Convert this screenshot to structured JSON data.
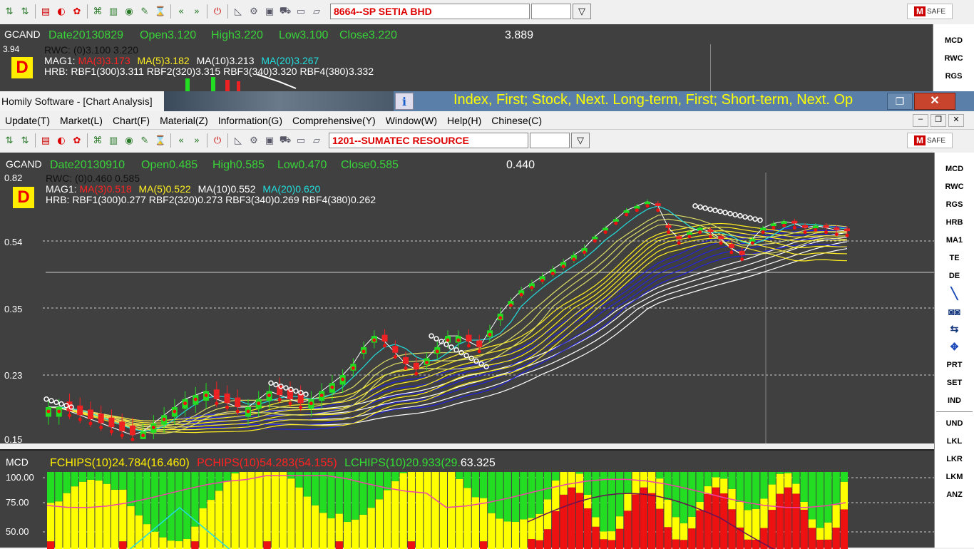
{
  "top_window": {
    "stock": "8664--SP SETIA BHD",
    "gcand": "GCAND",
    "date": "Date20130829",
    "open": "Open3.120",
    "high": "High3.220",
    "low": "Low3.100",
    "close": "Close3.220",
    "cursor_value": "3.889",
    "y_top": "3.94",
    "rwc": "RWC: (0)3.100   3.220",
    "mag1_prefix": "MAG1:",
    "ma3": "MA(3)3.173",
    "ma5": "MA(5)3.182",
    "ma10": "MA(10)3.213",
    "ma20": "MA(20)3.267",
    "hrb": "HRB: RBF1(300)3.311  RBF2(320)3.315  RBF3(340)3.320  RBF4(380)3.332",
    "d_badge": "D",
    "side": [
      "MCD",
      "RWC",
      "RGS"
    ]
  },
  "bar": {
    "title": "Homily Software - [Chart Analysis]",
    "info_icon": "i",
    "ticker": "Index, First; Stock, Next. Long-term, First; Short-term, Next. Op"
  },
  "menu": [
    "Update(T)",
    "Market(L)",
    "Chart(F)",
    "Material(Z)",
    "Information(G)",
    "Comprehensive(Y)",
    "Window(W)",
    "Help(H)",
    "Chinese(C)"
  ],
  "toolbar_icons": [
    "arrow-icon",
    "arrow-icon",
    "flag-my-icon",
    "flag-sg-icon",
    "flag-hk-icon",
    "tree-icon",
    "bars-icon",
    "drive-icon",
    "edit-icon",
    "hourglass-icon",
    "rewind-icon",
    "forward-icon",
    "power-icon",
    "chart-icon",
    "gear-icon",
    "frame-icon",
    "cart-icon",
    "folder-icon",
    "folder-open-icon"
  ],
  "main": {
    "stock": "1201--SUMATEC RESOURCE",
    "gcand": "GCAND",
    "date": "Date20130910",
    "open": "Open0.485",
    "high": "High0.585",
    "low": "Low0.470",
    "close": "Close0.585",
    "cursor_value": "0.440",
    "rwc": "RWC: (0)0.460   0.585",
    "mag1_prefix": "MAG1:",
    "ma3": "MA(3)0.518",
    "ma5": "MA(5)0.522",
    "ma10": "MA(10)0.552",
    "ma20": "MA(20)0.620",
    "hrb": "HRB: RBF1(300)0.277  RBF2(320)0.273  RBF3(340)0.269  RBF4(380)0.262",
    "d_badge": "D",
    "yticks": [
      "0.82",
      "0.54",
      "0.35",
      "0.23",
      "0.15"
    ],
    "side_top": [
      "MCD",
      "RWC",
      "RGS",
      "HRB",
      "MA1",
      "TE",
      "DE"
    ],
    "side_bottom": [
      "PRT",
      "SET",
      "IND",
      "UND",
      "LKL",
      "LKR",
      "LKM",
      "ANZ"
    ]
  },
  "mcd": {
    "label": "MCD",
    "fchips": "FCHIPS(10)24.784(16.460)",
    "pchips": "PCHIPS(10)54.283(54.155)",
    "lchips": "LCHIPS(10)20.933(29.",
    "lchips_tail": "63.325",
    "yticks": [
      "100.00",
      "75.00",
      "50.00"
    ]
  },
  "chart_data": [
    {
      "type": "candlestick",
      "title": "1201--SUMATEC RESOURCE",
      "ylim": [
        0.15,
        0.82
      ],
      "yticks": [
        0.82,
        0.54,
        0.35,
        0.23,
        0.15
      ],
      "close_path": [
        0.19,
        0.19,
        0.185,
        0.18,
        0.175,
        0.17,
        0.165,
        0.16,
        0.155,
        0.16,
        0.17,
        0.18,
        0.19,
        0.2,
        0.205,
        0.21,
        0.2,
        0.195,
        0.19,
        0.19,
        0.2,
        0.21,
        0.205,
        0.2,
        0.195,
        0.2,
        0.21,
        0.22,
        0.23,
        0.25,
        0.28,
        0.3,
        0.29,
        0.27,
        0.25,
        0.24,
        0.26,
        0.28,
        0.3,
        0.3,
        0.29,
        0.28,
        0.31,
        0.34,
        0.37,
        0.4,
        0.42,
        0.44,
        0.46,
        0.48,
        0.5,
        0.52,
        0.56,
        0.6,
        0.64,
        0.68,
        0.7,
        0.72,
        0.7,
        0.6,
        0.55,
        0.58,
        0.6,
        0.58,
        0.55,
        0.52,
        0.5,
        0.55,
        0.6,
        0.62,
        0.63,
        0.62,
        0.6,
        0.61,
        0.6,
        0.59,
        0.585
      ],
      "colors": {
        "up": "#22dd22",
        "down": "#ee2222"
      }
    },
    {
      "type": "bar",
      "title": "MCD",
      "ylim": [
        0,
        100
      ],
      "series": [
        {
          "name": "FCHIPS",
          "color": "#22dd22"
        },
        {
          "name": "PCHIPS",
          "color": "#ee1111"
        },
        {
          "name": "LCHIPS",
          "color": "#ffff00"
        }
      ]
    }
  ]
}
